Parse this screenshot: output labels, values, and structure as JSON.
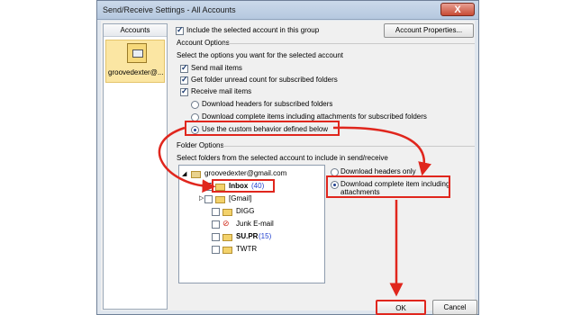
{
  "window": {
    "title": "Send/Receive Settings - All Accounts",
    "close_label": "X"
  },
  "accounts": {
    "header": "Accounts",
    "selected": "groovedexter@..."
  },
  "include_checkbox": {
    "label": "Include the selected account in this group",
    "checked": true
  },
  "account_properties_button": "Account Properties...",
  "account_options": {
    "title": "Account Options",
    "instruction": "Select the options you want for the selected account",
    "send_mail": "Send mail items",
    "unread_count": "Get folder unread count for subscribed folders",
    "receive_mail": "Receive mail items",
    "download_headers": "Download headers for subscribed folders",
    "download_complete": "Download complete items including attachments for subscribed folders",
    "custom_behavior": "Use the custom behavior defined below"
  },
  "folder_options": {
    "title": "Folder Options",
    "instruction": "Select folders from the selected account to include in send/receive",
    "root": "groovedexter@gmail.com",
    "folders": [
      {
        "name": "Inbox",
        "count": "(40)",
        "checked": true
      },
      {
        "name": "[Gmail]",
        "count": "",
        "checked": false
      },
      {
        "name": "DIGG",
        "count": "",
        "checked": false
      },
      {
        "name": "Junk E-mail",
        "count": "",
        "checked": false
      },
      {
        "name": "SU.PR",
        "count": "(15)",
        "checked": false
      },
      {
        "name": "TWTR",
        "count": "",
        "checked": false
      }
    ],
    "download_headers_only": "Download headers only",
    "download_complete_line1": "Download complete item including",
    "download_complete_line2": "attachments"
  },
  "ok_button": "OK",
  "cancel_button": "Cancel",
  "colors": {
    "annotation_red": "#e0261d",
    "count_blue": "#1f3fcf"
  }
}
